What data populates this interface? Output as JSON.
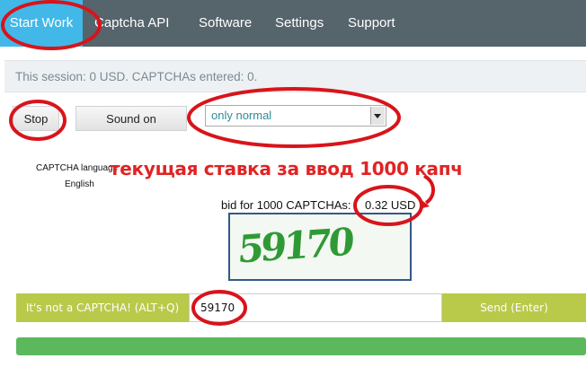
{
  "nav": {
    "items": [
      {
        "label": "Start Work"
      },
      {
        "label": "Captcha API"
      },
      {
        "label": "Software"
      },
      {
        "label": "Settings"
      },
      {
        "label": "Support"
      }
    ]
  },
  "session": {
    "text": "This session: 0 USD. CAPTCHAs entered: 0."
  },
  "controls": {
    "stop_label": "Stop",
    "sound_label": "Sound on",
    "mode_selected": "only normal"
  },
  "captcha_language": {
    "label": "CAPTCHA language",
    "value": "English"
  },
  "annotation": {
    "text": "текущая ставка за ввод 1000 капч",
    "color": "#e02424"
  },
  "bid": {
    "label": "bid for 1000 CAPTCHAs:",
    "value": "0.32 USD"
  },
  "captcha_image": {
    "text": "59170"
  },
  "answer_bar": {
    "not_captcha_label": "It's not a CAPTCHA! (ALT+Q)",
    "answer_value": "59170",
    "send_label": "Send (Enter)"
  },
  "progress": {
    "fraction": 1.0
  },
  "colors": {
    "nav": "#56646c",
    "nav_active": "#41b8e8",
    "bar": "#b9c94a",
    "progress": "#5cb85c",
    "highlight": "#d8141b"
  }
}
